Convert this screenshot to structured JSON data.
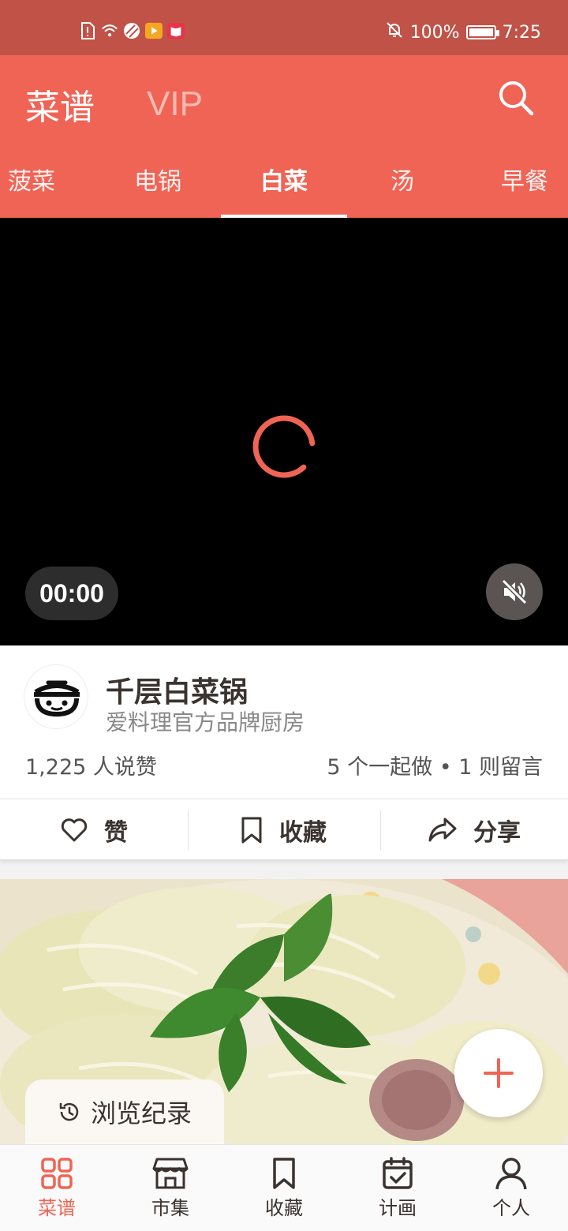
{
  "status_bar": {
    "battery": "100%",
    "time": "7:25",
    "battery_level": 1.0
  },
  "header": {
    "title": "菜谱",
    "vip_label": "VIP"
  },
  "tabs": [
    {
      "label": "菠菜",
      "active": false
    },
    {
      "label": "电锅",
      "active": false
    },
    {
      "label": "白菜",
      "active": true
    },
    {
      "label": "汤",
      "active": false
    },
    {
      "label": "早餐",
      "active": false
    }
  ],
  "video": {
    "time": "00:00",
    "muted": true
  },
  "recipe": {
    "title": "千层白菜锅",
    "author": "爱料理官方品牌厨房",
    "likes": "1,225 人说赞",
    "together": "5 个一起做 • 1 则留言"
  },
  "actions": {
    "like": "赞",
    "save": "收藏",
    "share": "分享"
  },
  "history_label": "浏览纪录",
  "bottom_nav": [
    {
      "label": "菜谱",
      "icon": "grid-icon",
      "active": true
    },
    {
      "label": "市集",
      "icon": "store-icon",
      "active": false
    },
    {
      "label": "收藏",
      "icon": "bookmark-icon",
      "active": false
    },
    {
      "label": "计画",
      "icon": "calendar-check-icon",
      "active": false
    },
    {
      "label": "个人",
      "icon": "person-icon",
      "active": false
    }
  ],
  "colors": {
    "accent": "#f06455",
    "status_bar": "#c15247",
    "text_dark": "#3a3330"
  }
}
